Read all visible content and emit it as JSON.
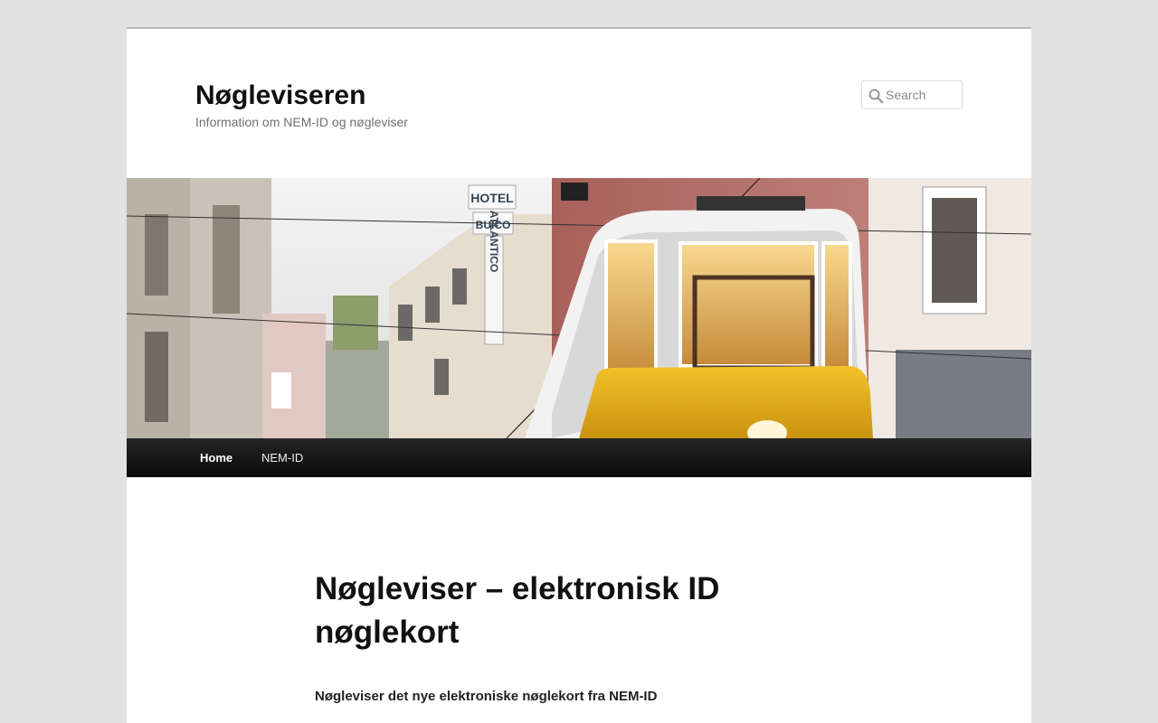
{
  "site": {
    "title": "Nøgleviseren",
    "description": "Information om NEM-ID og nøgleviser"
  },
  "search": {
    "placeholder": "Search"
  },
  "banner": {
    "sign_top": "HOTEL",
    "sign_name": "BUICO",
    "sign_vertical": "ATLANTICO"
  },
  "nav": {
    "items": [
      {
        "label": "Home"
      },
      {
        "label": "NEM-ID"
      }
    ]
  },
  "post": {
    "title_line1": "Nøgleviser – elektronisk ID",
    "title_line2": "nøglekort",
    "subtitle": "Nøgleviser det nye elektroniske nøglekort fra NEM-ID"
  },
  "colors": {
    "page_bg": "#e2e2e2",
    "tram_yellow": "#e7b21c",
    "nav_bg": "#111111"
  }
}
